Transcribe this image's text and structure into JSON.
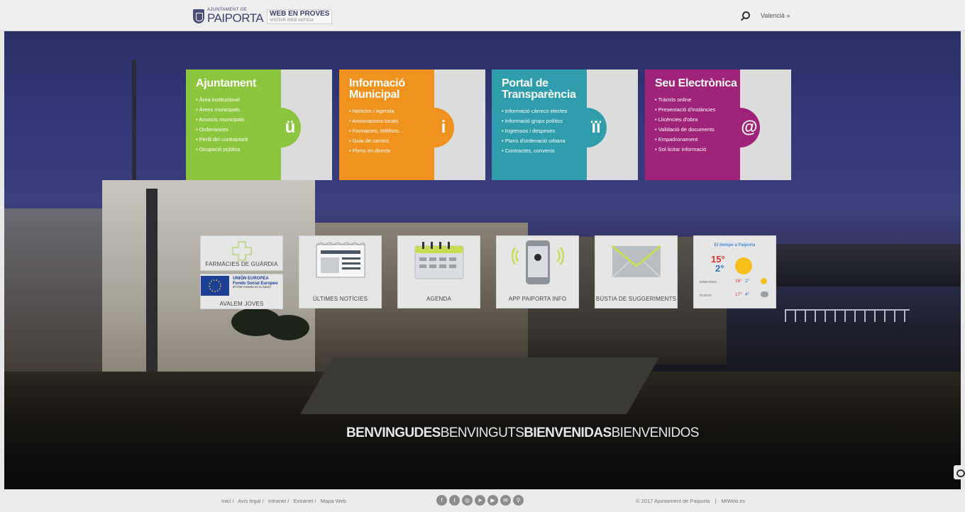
{
  "header": {
    "logo_small": "AJUNTAMENT DE",
    "logo_big": "PAIPORTA",
    "proves_line1": "WEB EN PROVES",
    "proves_line2": "VISITAR WEB ANTIGA",
    "language": "Valencià »"
  },
  "cards": [
    {
      "title": "Ajuntament",
      "color": "#8cc63f",
      "glyph": "ü",
      "items": [
        "Àrea institucional",
        "Àrees municipals",
        "Anuncis municipals",
        "Ordenances",
        "Perfil del contractant",
        "Ocupació pública"
      ]
    },
    {
      "title": "Informació Municipal",
      "color": "#f0931e",
      "glyph": "i",
      "items": [
        "Notícies / Agenda",
        "Associacions locals",
        "Farmàcies, telèfons...",
        "Guia de carrers",
        "Plens en directe"
      ]
    },
    {
      "title": "Portal de Transparència",
      "color": "#2f9dac",
      "glyph": "ïï",
      "items": [
        "Informació càrrecs electes",
        "Informació grups polítics",
        "Ingressos i despeses",
        "Plans d'ordenació urbana",
        "Contractes, convenis"
      ]
    },
    {
      "title": "Seu Electrònica",
      "color": "#a0237a",
      "glyph": "@",
      "items": [
        "Tràmits online",
        "Presentació d'instàncies",
        "Llicències d'obra",
        "Validació de documents",
        "Empadronament",
        "Sol·licitar informació"
      ]
    }
  ],
  "tiles": {
    "farmacies": "FARMÀCIES DE GUÀRDIA",
    "avalem": "AVALEM JOVES",
    "eu_line1": "UNIÓN EUROPEA",
    "eu_line2": "Fondo Social Europeo",
    "eu_line3": "El FSE invierte en tu futuro",
    "noticies": "ÚLTIMES NOTÍCIES",
    "agenda": "AGENDA",
    "app": "APP PAIPORTA INFO",
    "bustia": "BÚSTIA DE SUGGERIMENTS"
  },
  "weather": {
    "title": "El tiempo a Paiporta",
    "today_max": "15°",
    "today_min": "2°",
    "day1_name": "DIMECRES",
    "day1_max": "16°",
    "day1_min": "2°",
    "day2_name": "DIJOUS",
    "day2_max": "17°",
    "day2_min": "4°"
  },
  "welcome": {
    "w1": "BENVINGUDES",
    "w2": "BENVINGUTS",
    "w3": "BIENVENIDAS",
    "w4": "BIENVENIDOS"
  },
  "footer": {
    "links": [
      "Inici /",
      "Avís legal /",
      "Intranet /",
      "Extranet /",
      "Mapa Web"
    ],
    "social_icons": [
      "facebook-icon",
      "twitter-icon",
      "instagram-icon",
      "telegram-icon",
      "youtube-icon",
      "mail-icon",
      "location-icon"
    ],
    "copyright": "© 2017 Ajuntament de Paiporta",
    "separator": "|",
    "credit": "MtWeb.es"
  }
}
